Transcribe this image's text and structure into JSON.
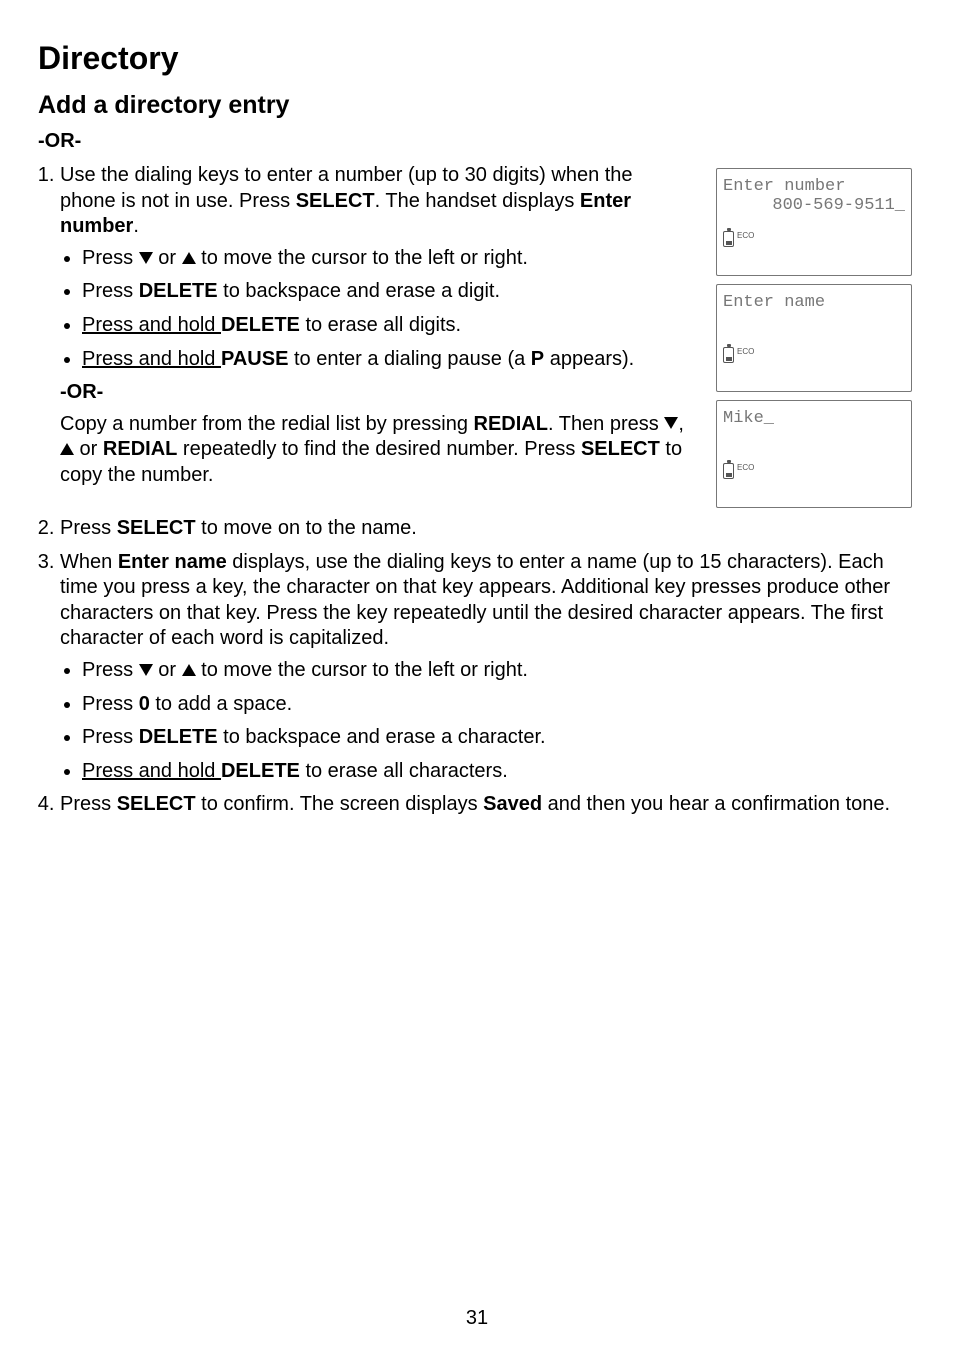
{
  "title": "Directory",
  "subtitle": "Add a directory entry",
  "or_label": "-OR-",
  "step1": {
    "pre": "Use the dialing keys to enter a number (up to 30 digits) when the phone is not in use. Press ",
    "select": "SELECT",
    "mid": ". The handset displays ",
    "enter_number": "Enter number",
    "post": "."
  },
  "step1_bullets": {
    "b1_pre": "Press ",
    "b1_mid": " or ",
    "b1_post": " to move the cursor to the left or right.",
    "b2_pre": "Press ",
    "b2_delete": "DELETE",
    "b2_post": " to backspace and erase a digit.",
    "b3_pre": "Press and hold ",
    "b3_delete": "DELETE",
    "b3_post": " to erase all digits.",
    "b4_pre": "Press and hold ",
    "b4_pause": "PAUSE",
    "b4_mid": " to enter a dialing pause (a ",
    "b4_p": "P",
    "b4_post": " appears)."
  },
  "redial": {
    "pre": "Copy a number from the redial list by pressing ",
    "redial": "REDIAL",
    "mid1": ". Then press ",
    "comma": ", ",
    "or": " or ",
    "redial2": "REDIAL",
    "mid2": " repeatedly to find the desired number. Press ",
    "select": "SELECT",
    "post": " to copy the number."
  },
  "step2": {
    "pre": "Press ",
    "select": "SELECT",
    "post": " to move on to the name."
  },
  "step3": {
    "pre": "When ",
    "enter_name": "Enter name",
    "post": " displays, use the dialing keys to enter a name (up to 15 characters). Each time you press a key, the character on that key appears. Additional key presses produce other characters on that key. Press the key repeatedly until the desired character appears. The first character of each word is capitalized."
  },
  "step3_bullets": {
    "b1_pre": "Press ",
    "b1_mid": " or ",
    "b1_post": " to move the cursor to the left or right.",
    "b2_pre": "Press ",
    "b2_zero": "0",
    "b2_post": " to add a space.",
    "b3_pre": "Press ",
    "b3_delete": "DELETE",
    "b3_post": " to backspace and erase a character.",
    "b4_pre": "Press and hold ",
    "b4_delete": "DELETE",
    "b4_post": " to erase all characters."
  },
  "step4": {
    "pre": "Press ",
    "select": "SELECT",
    "mid": " to confirm. The screen displays ",
    "saved": "Saved",
    "post": " and then you hear a confirmation tone."
  },
  "screens": {
    "s1_line1": "Enter number",
    "s1_line2": "800-569-9511_",
    "s2_line1": "Enter name",
    "s3_line1": "Mike_",
    "eco": "ECO"
  },
  "page_number": "31"
}
